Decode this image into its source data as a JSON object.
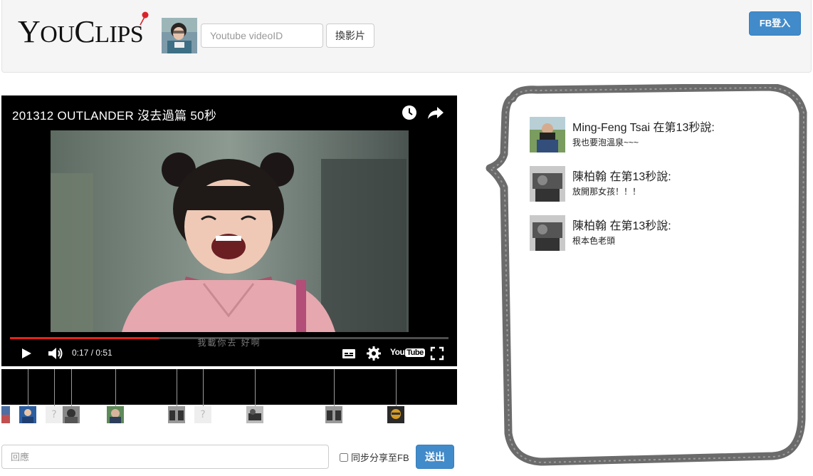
{
  "header": {
    "logo_text_first": "Y",
    "logo_text_second": "OU",
    "logo_text_third": "C",
    "logo_text_fourth": "LIPS",
    "video_id_placeholder": "Youtube videoID",
    "switch_video_label": "換影片",
    "fb_login_label": "FB登入"
  },
  "player": {
    "title": "201312 OUTLANDER 沒去過篇 50秒",
    "current_time": "0:17",
    "time_separator": " / ",
    "duration": "0:51",
    "progress_fraction": 0.34,
    "subtitle": "我載你去 好啊",
    "youtube_label_you": "You",
    "youtube_label_tube": "Tube",
    "accent_color": "#e62117"
  },
  "timeline": {
    "markers_count_visible": 12
  },
  "reply": {
    "placeholder": "回應",
    "share_to_fb_label": "同步分享至FB",
    "share_to_fb_checked": false,
    "send_label": "送出"
  },
  "comments": [
    {
      "author": "Ming-Feng Tsai",
      "at_time": "在第13秒說:",
      "text": "我也要泡溫泉~~~"
    },
    {
      "author": "陳柏翰",
      "at_time": "在第13秒說:",
      "text": "放開那女孩！！！"
    },
    {
      "author": "陳柏翰",
      "at_time": "在第13秒說:",
      "text": "根本色老頭"
    }
  ],
  "colors": {
    "primary_button": "#428bca",
    "navbar_bg": "#f5f5f5",
    "bubble_outline": "#6b6b6b"
  }
}
